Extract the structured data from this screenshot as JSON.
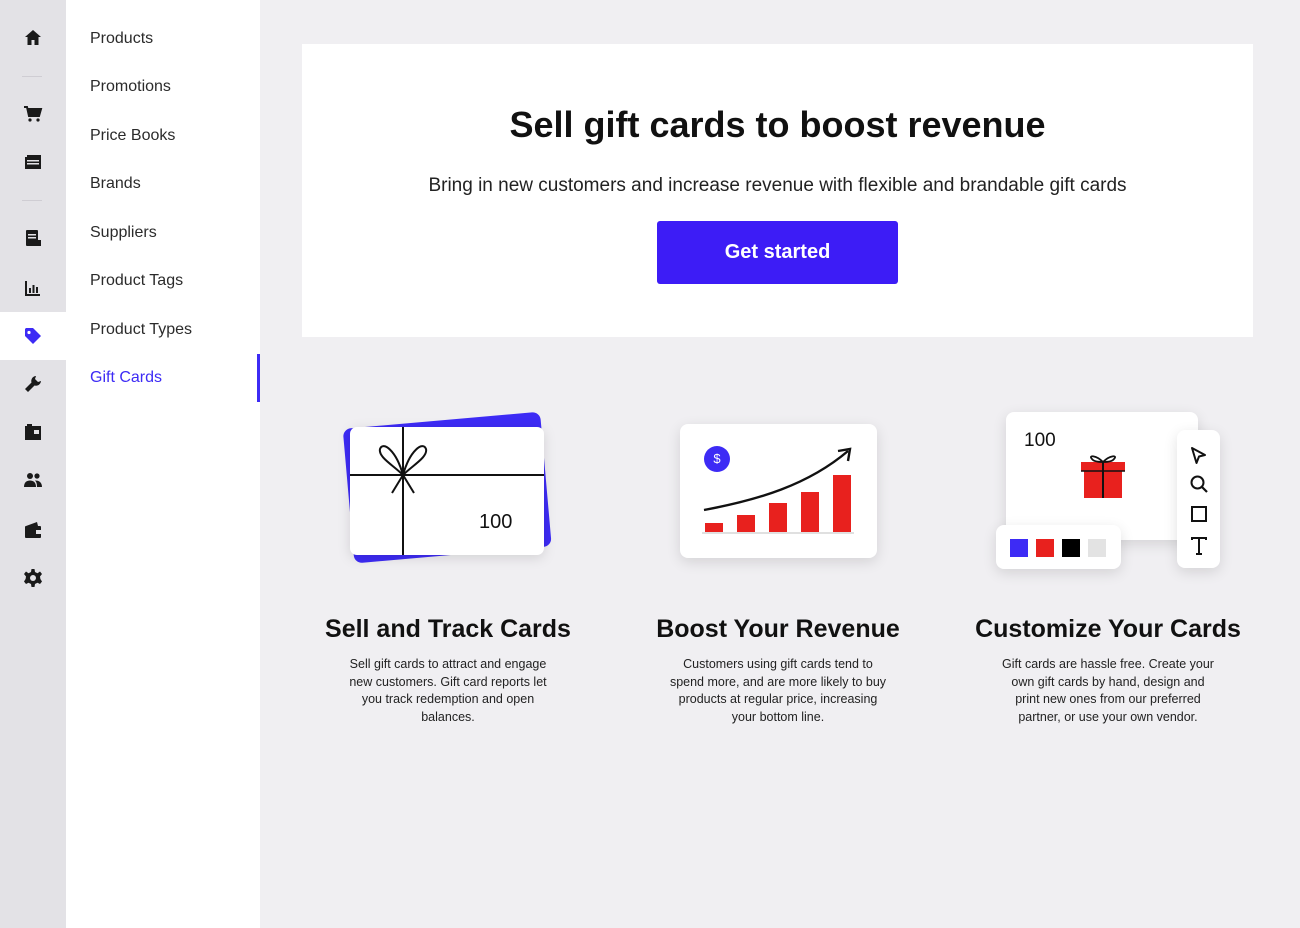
{
  "rail": {
    "items": [
      {
        "name": "home-icon",
        "active": false
      },
      {
        "name": "cart-icon",
        "active": false
      },
      {
        "name": "register-icon",
        "active": false
      },
      {
        "name": "document-icon",
        "active": false
      },
      {
        "name": "reports-icon",
        "active": false
      },
      {
        "name": "tag-icon",
        "active": true
      },
      {
        "name": "wrench-icon",
        "active": false
      },
      {
        "name": "inventory-icon",
        "active": false
      },
      {
        "name": "customers-icon",
        "active": false
      },
      {
        "name": "wallet-icon",
        "active": false
      },
      {
        "name": "settings-icon",
        "active": false
      }
    ]
  },
  "subnav": {
    "items": [
      {
        "label": "Products"
      },
      {
        "label": "Promotions"
      },
      {
        "label": "Price Books"
      },
      {
        "label": "Brands"
      },
      {
        "label": "Suppliers"
      },
      {
        "label": "Product Tags"
      },
      {
        "label": "Product Types"
      },
      {
        "label": "Gift Cards",
        "active": true
      }
    ]
  },
  "hero": {
    "title": "Sell gift cards to boost revenue",
    "subtitle": "Bring in new customers and increase revenue with flexible and brandable gift cards",
    "cta_label": "Get started"
  },
  "features": [
    {
      "title": "Sell and Track Cards",
      "description": "Sell gift cards to attract and engage new customers. Gift card reports let you track redemption and open balances.",
      "card_value": "100"
    },
    {
      "title": "Boost Your Revenue",
      "description": "Customers using gift cards tend to spend more, and are more likely to buy products at regular price, increasing your bottom line.",
      "currency_symbol": "$"
    },
    {
      "title": "Customize Your Cards",
      "description": "Gift cards are hassle free. Create your own gift cards by hand, design and print new ones from our preferred partner, or use your own vendor.",
      "card_value": "100",
      "swatches": [
        "#3d2bf5",
        "#e8211e",
        "#000000",
        "#e3e3e3"
      ]
    }
  ],
  "colors": {
    "accent": "#3d1cf6",
    "illustration_red": "#e8211e"
  }
}
